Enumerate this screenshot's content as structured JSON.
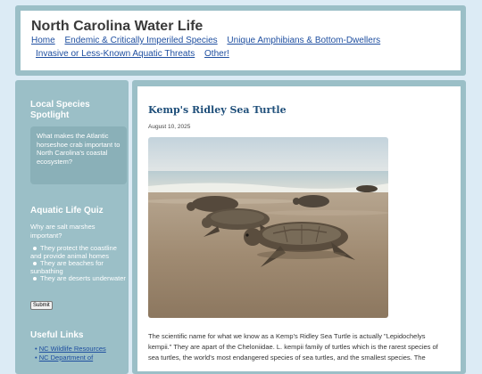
{
  "header": {
    "title": "North Carolina Water Life",
    "nav": [
      "Home",
      "Endemic & Critically Imperiled Species",
      "Unique Amphibians & Bottom-Dwellers",
      "Invasive or Less-Known Aquatic Threats",
      "Other!"
    ]
  },
  "sidebar": {
    "spotlight": {
      "heading": "Local Species Spotlight",
      "text": "What makes the Atlantic horseshoe crab important to North Carolina's coastal ecosystem?"
    },
    "quiz": {
      "heading": "Aquatic Life Quiz",
      "question": "Why are salt marshes important?",
      "options": [
        "They protect the coastline and provide animal homes",
        "They are beaches for sunbathing",
        "They are deserts underwater"
      ],
      "submit_label": "Submit"
    },
    "links": {
      "heading": "Useful Links",
      "items": [
        "NC Wildlife Resources",
        "NC Department of"
      ]
    }
  },
  "post": {
    "title": "Kemp's Ridley Sea Turtle",
    "date": "August 10, 2025",
    "body": "The scientific name for what we know as a Kemp's Ridley Sea Turtle is actually \"Lepidochelys kempii.\" They are apart of the Cheloniidae. L. kempii family of turtles which is the rarest species of sea turtles, the world's most endangered species of sea turtles, and the smallest species. The"
  },
  "colors": {
    "page_bg": "#dcebf5",
    "panel": "#9bbfc7",
    "link": "#1f4fa0",
    "post_title": "#1f4f7a"
  }
}
